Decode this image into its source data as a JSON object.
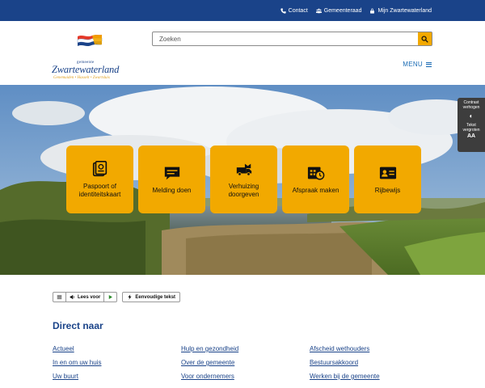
{
  "topbar": {
    "links": [
      {
        "label": "Contact",
        "icon": "phone-icon"
      },
      {
        "label": "Gemeenteraad",
        "icon": "council-icon"
      },
      {
        "label": "Mijn Zwartewaterland",
        "icon": "lock-icon"
      }
    ]
  },
  "logo": {
    "small": "gemeente",
    "name": "Zwartewaterland",
    "sub": "Genemuiden • Hasselt • Zwartsluis"
  },
  "search": {
    "placeholder": "Zoeken"
  },
  "menu": {
    "label": "MENU"
  },
  "tiles": [
    {
      "label": "Paspoort of identiteitskaart",
      "icon": "passport-icon"
    },
    {
      "label": "Melding doen",
      "icon": "chat-icon"
    },
    {
      "label": "Verhuizing doorgeven",
      "icon": "moving-truck-icon"
    },
    {
      "label": "Afspraak maken",
      "icon": "calendar-clock-icon"
    },
    {
      "label": "Rijbewijs",
      "icon": "id-card-icon"
    }
  ],
  "accessibility": {
    "contrast": "Contrast verhogen",
    "text": "Tekst vergroten",
    "text_icon": "AA"
  },
  "readbar": {
    "read_aloud": "Lees voor",
    "easy_text": "Eenvoudige tekst"
  },
  "direct": {
    "title": "Direct naar",
    "links": [
      "Actueel",
      "Hulp en gezondheid",
      "Afscheid wethouders",
      "In en om uw huis",
      "Over de gemeente",
      "Bestuursakkoord",
      "Uw buurt",
      "Voor ondernemers",
      "Werken bij de gemeente"
    ]
  },
  "colors": {
    "primary": "#1a4389",
    "accent": "#f2a900",
    "link": "#1a6bb4"
  }
}
